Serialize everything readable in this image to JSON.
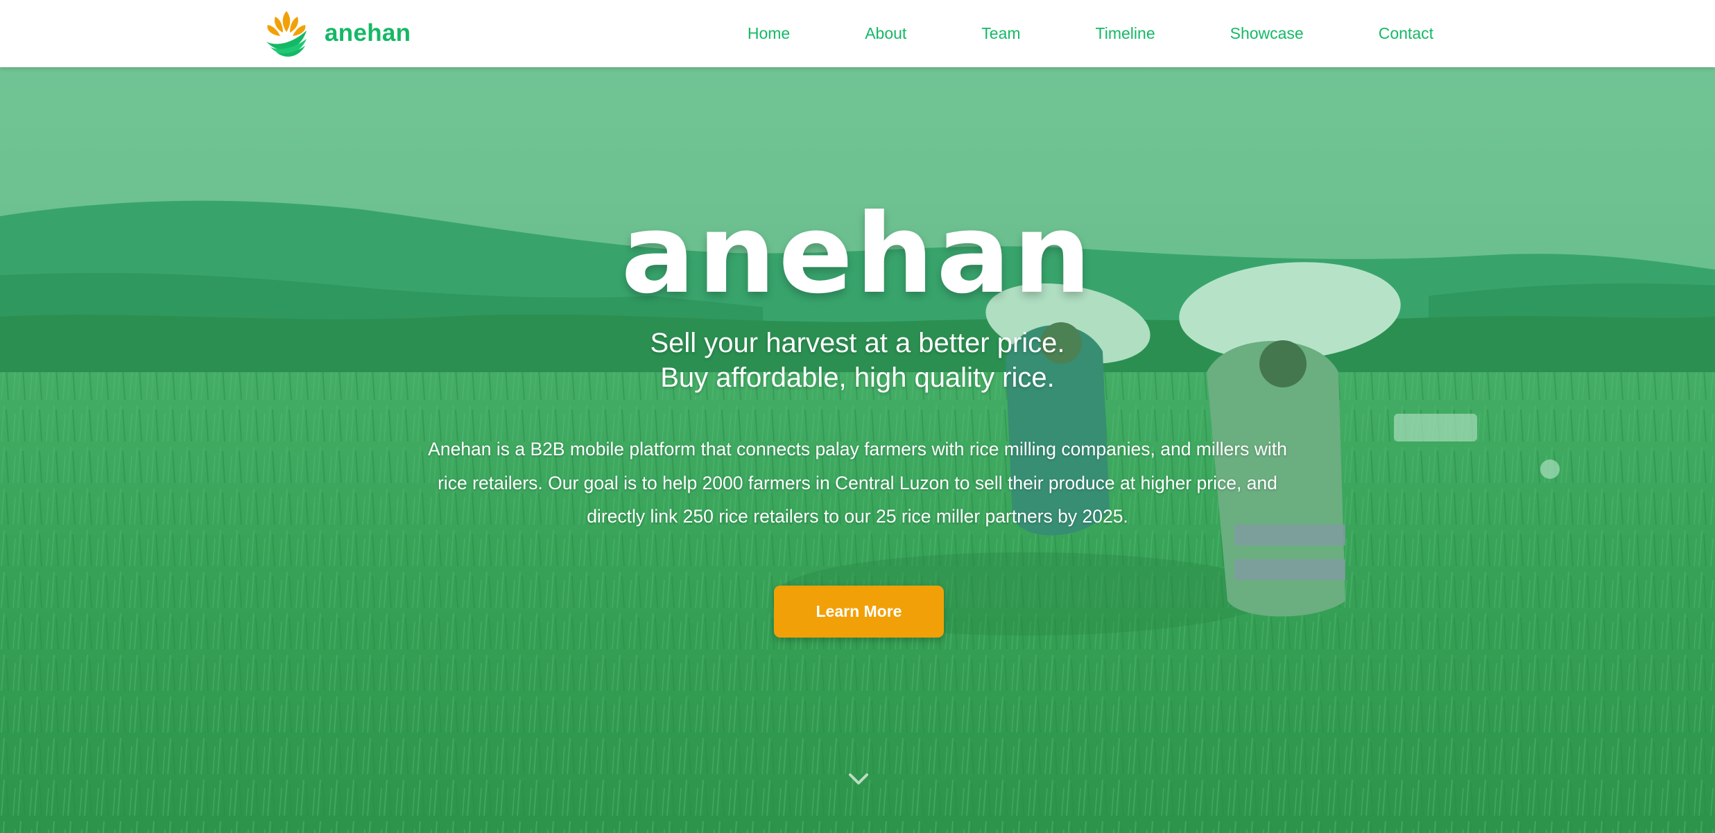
{
  "colors": {
    "brand_green": "#15b866",
    "accent_orange": "#f2a007",
    "overlay_green": "#26b969",
    "navbar_bg": "#ffffff"
  },
  "navbar": {
    "brand_name": "anehan",
    "logo_icon": "rice-sprout-logo-icon",
    "links": [
      {
        "label": "Home"
      },
      {
        "label": "About"
      },
      {
        "label": "Team"
      },
      {
        "label": "Timeline"
      },
      {
        "label": "Showcase"
      },
      {
        "label": "Contact"
      }
    ]
  },
  "hero": {
    "background": "rice-field-farmers-carrying-sacks-photo",
    "title": "anehan",
    "tagline_line1": "Sell your harvest at a better price.",
    "tagline_line2": "Buy affordable, high quality rice.",
    "description": "Anehan is a B2B mobile platform that connects palay farmers with rice milling companies, and millers with rice retailers. Our goal is to help 2000 farmers in Central Luzon to sell their produce at higher price, and directly link 250 rice retailers to our 25 rice miller partners by 2025.",
    "cta_label": "Learn More",
    "scroll_icon": "chevron-down-icon"
  }
}
